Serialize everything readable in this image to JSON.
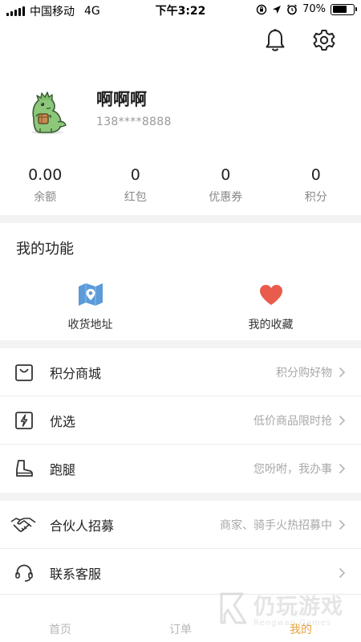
{
  "status_bar": {
    "carrier": "中国移动",
    "network": "4G",
    "time": "下午3:22",
    "battery": "70%",
    "battery_level": 0.7
  },
  "profile": {
    "name": "啊啊啊",
    "phone": "138****8888"
  },
  "stats": [
    {
      "value": "0.00",
      "label": "余额"
    },
    {
      "value": "0",
      "label": "红包"
    },
    {
      "value": "0",
      "label": "优惠券"
    },
    {
      "value": "0",
      "label": "积分"
    }
  ],
  "functions": {
    "title": "我的功能",
    "items": [
      {
        "label": "收货地址",
        "icon": "map-location-icon"
      },
      {
        "label": "我的收藏",
        "icon": "heart-icon"
      }
    ]
  },
  "menu": [
    {
      "label": "积分商城",
      "hint": "积分购好物",
      "icon": "shopping-bag-icon"
    },
    {
      "label": "优选",
      "hint": "低价商品限时抢",
      "icon": "lightning-icon"
    },
    {
      "label": "跑腿",
      "hint": "您吩咐，我办事",
      "icon": "boot-icon"
    },
    {
      "label": "合伙人招募",
      "hint": "商家、骑手火热招募中",
      "icon": "handshake-icon"
    },
    {
      "label": "联系客服",
      "hint": "",
      "icon": "headset-icon"
    }
  ],
  "tabs": [
    {
      "label": "首页"
    },
    {
      "label": "订单"
    },
    {
      "label": "我的"
    }
  ],
  "watermark": {
    "title": "仍玩游戏",
    "subtitle": "Rengwan Games"
  },
  "colors": {
    "accent": "#e8a33c",
    "map_blue": "#5b9bd9",
    "heart_red": "#e95b4b",
    "section_bg": "#f3f3f3"
  }
}
